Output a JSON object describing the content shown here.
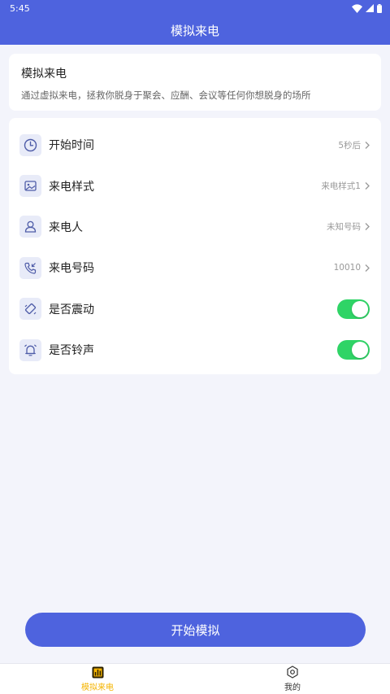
{
  "status_bar": {
    "time": "5:45"
  },
  "app_bar": {
    "title": "模拟来电"
  },
  "intro": {
    "title": "模拟来电",
    "description": "通过虚拟来电，拯救你脱身于聚会、应酬、会议等任何你想脱身的场所"
  },
  "settings": [
    {
      "label": "开始时间",
      "value": "5秒后",
      "icon": "clock-icon"
    },
    {
      "label": "来电样式",
      "value": "来电样式1",
      "icon": "image-icon"
    },
    {
      "label": "来电人",
      "value": "未知号码",
      "icon": "person-icon"
    },
    {
      "label": "来电号码",
      "value": "10010",
      "icon": "phone-incoming-icon"
    },
    {
      "label": "是否震动",
      "toggle": true,
      "icon": "vibrate-icon"
    },
    {
      "label": "是否铃声",
      "toggle": true,
      "icon": "bell-icon"
    }
  ],
  "start_button": {
    "label": "开始模拟"
  },
  "bottom_nav": [
    {
      "label": "模拟来电",
      "active": true,
      "icon": "bar-chart-icon"
    },
    {
      "label": "我的",
      "active": false,
      "icon": "hex-gear-icon"
    }
  ],
  "colors": {
    "primary": "#4e63de",
    "toggle_on": "#2fd466",
    "nav_active": "#f5b400",
    "background": "#f3f4fb"
  }
}
